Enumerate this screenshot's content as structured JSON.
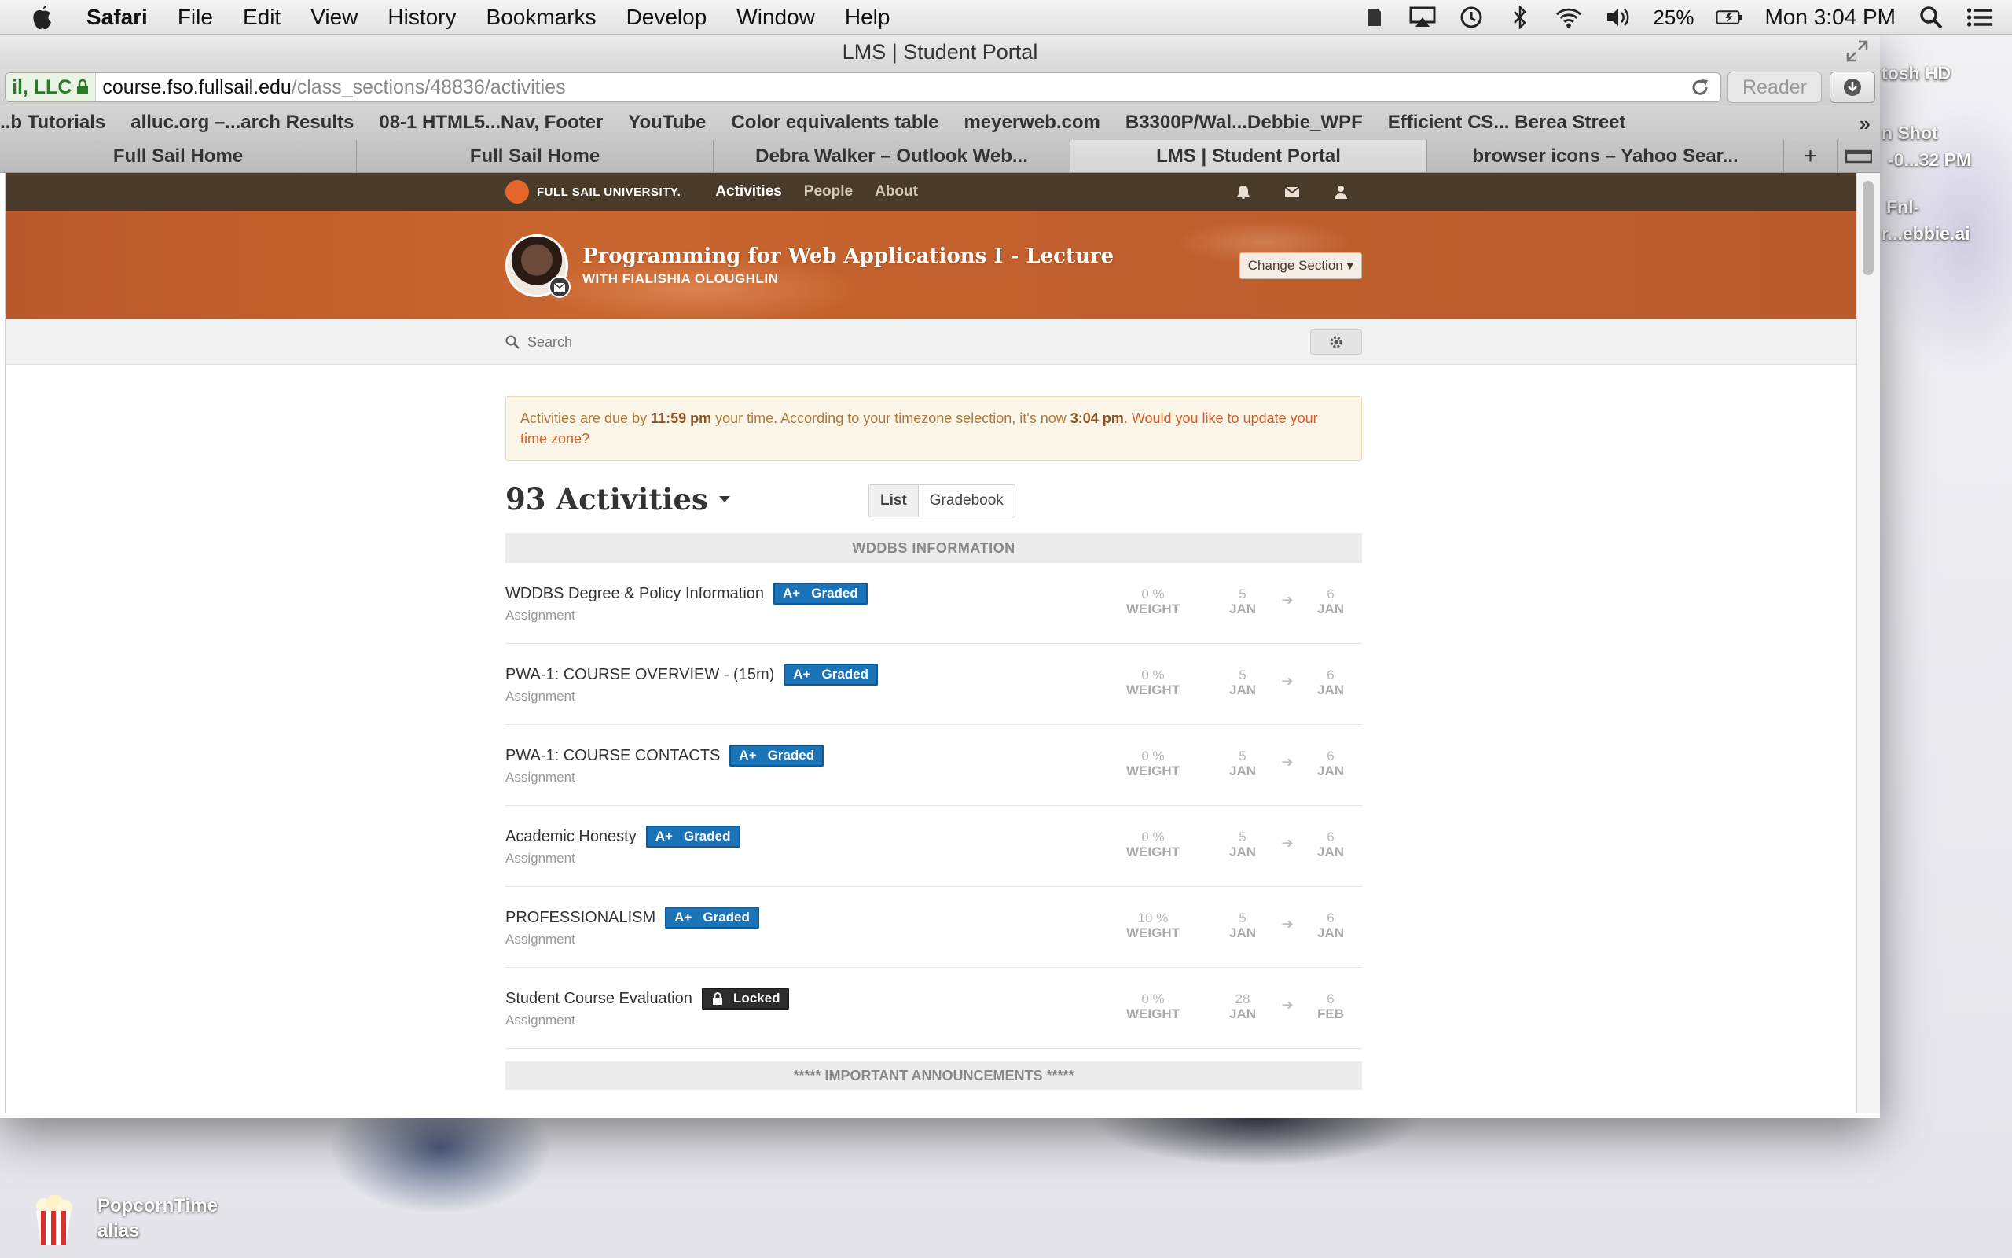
{
  "menubar": {
    "app": "Safari",
    "items": [
      "File",
      "Edit",
      "View",
      "History",
      "Bookmarks",
      "Develop",
      "Window",
      "Help"
    ],
    "battery": "25%",
    "clock": "Mon 3:04 PM"
  },
  "window": {
    "title": "LMS | Student Portal",
    "url_ev": "il, LLC",
    "url_host": "course.fso.fullsail.edu",
    "url_path": "/class_sections/48836/activities",
    "reader": "Reader"
  },
  "bookmarks": [
    "..b Tutorials",
    "alluc.org –...arch Results",
    "08-1 HTML5...Nav, Footer",
    "YouTube",
    "Color equivalents table",
    "meyerweb.com",
    "B3300P/Wal...Debbie_WPF",
    "Efficient CS... Berea Street"
  ],
  "tabs": [
    "Full Sail Home",
    "Full Sail Home",
    "Debra Walker – Outlook Web...",
    "LMS | Student Portal",
    "browser icons – Yahoo Sear..."
  ],
  "site": {
    "logo": "FULL SAIL UNIVERSITY.",
    "nav": [
      "Activities",
      "People",
      "About"
    ]
  },
  "course": {
    "title": "Programming for Web Applications I - Lecture",
    "instructor": "WITH FIALISHIA OLOUGHLIN",
    "change_section": "Change Section ▾"
  },
  "search": {
    "placeholder": "Search"
  },
  "alert": {
    "p1": "Activities are due by ",
    "due": "11:59 pm",
    "p2": " your time. According to your timezone selection, it's now ",
    "now": "3:04 pm",
    "p3": ". ",
    "link": "Would you like to update your time zone?"
  },
  "activities": {
    "count": "93 Activities",
    "views": [
      "List",
      "Gradebook"
    ],
    "section1": "WDDBS INFORMATION",
    "section2": "***** IMPORTANT ANNOUNCEMENTS *****",
    "weight_label": "WEIGHT",
    "rows": [
      {
        "name": "WDDBS Degree & Policy Information",
        "type": "Assignment",
        "grade": "A+",
        "status": "Graded",
        "weight": "0 %",
        "start_day": "5",
        "start_mon": "JAN",
        "end_day": "6",
        "end_mon": "JAN"
      },
      {
        "name": "PWA-1: COURSE OVERVIEW - (15m)",
        "type": "Assignment",
        "grade": "A+",
        "status": "Graded",
        "weight": "0 %",
        "start_day": "5",
        "start_mon": "JAN",
        "end_day": "6",
        "end_mon": "JAN"
      },
      {
        "name": "PWA-1: COURSE CONTACTS",
        "type": "Assignment",
        "grade": "A+",
        "status": "Graded",
        "weight": "0 %",
        "start_day": "5",
        "start_mon": "JAN",
        "end_day": "6",
        "end_mon": "JAN"
      },
      {
        "name": "Academic Honesty",
        "type": "Assignment",
        "grade": "A+",
        "status": "Graded",
        "weight": "0 %",
        "start_day": "5",
        "start_mon": "JAN",
        "end_day": "6",
        "end_mon": "JAN"
      },
      {
        "name": "PROFESSIONALISM",
        "type": "Assignment",
        "grade": "A+",
        "status": "Graded",
        "weight": "10 %",
        "start_day": "5",
        "start_mon": "JAN",
        "end_day": "6",
        "end_mon": "JAN"
      },
      {
        "name": "Student Course Evaluation",
        "type": "Assignment",
        "grade": "",
        "status": "Locked",
        "weight": "0 %",
        "start_day": "28",
        "start_mon": "JAN",
        "end_day": "6",
        "end_mon": "FEB"
      }
    ]
  },
  "desktop": {
    "icons": [
      "tosh HD",
      "n Shot",
      "-0...32 PM",
      "Fnl-",
      "r...ebbie.ai"
    ],
    "popcorn_line1": "PopcornTime",
    "popcorn_line2": "alias"
  },
  "colors": {
    "brand_orange": "#c9652f",
    "site_bar": "#4a3a29",
    "graded_blue": "#1b73b8",
    "locked_dark": "#2d2d2d"
  }
}
